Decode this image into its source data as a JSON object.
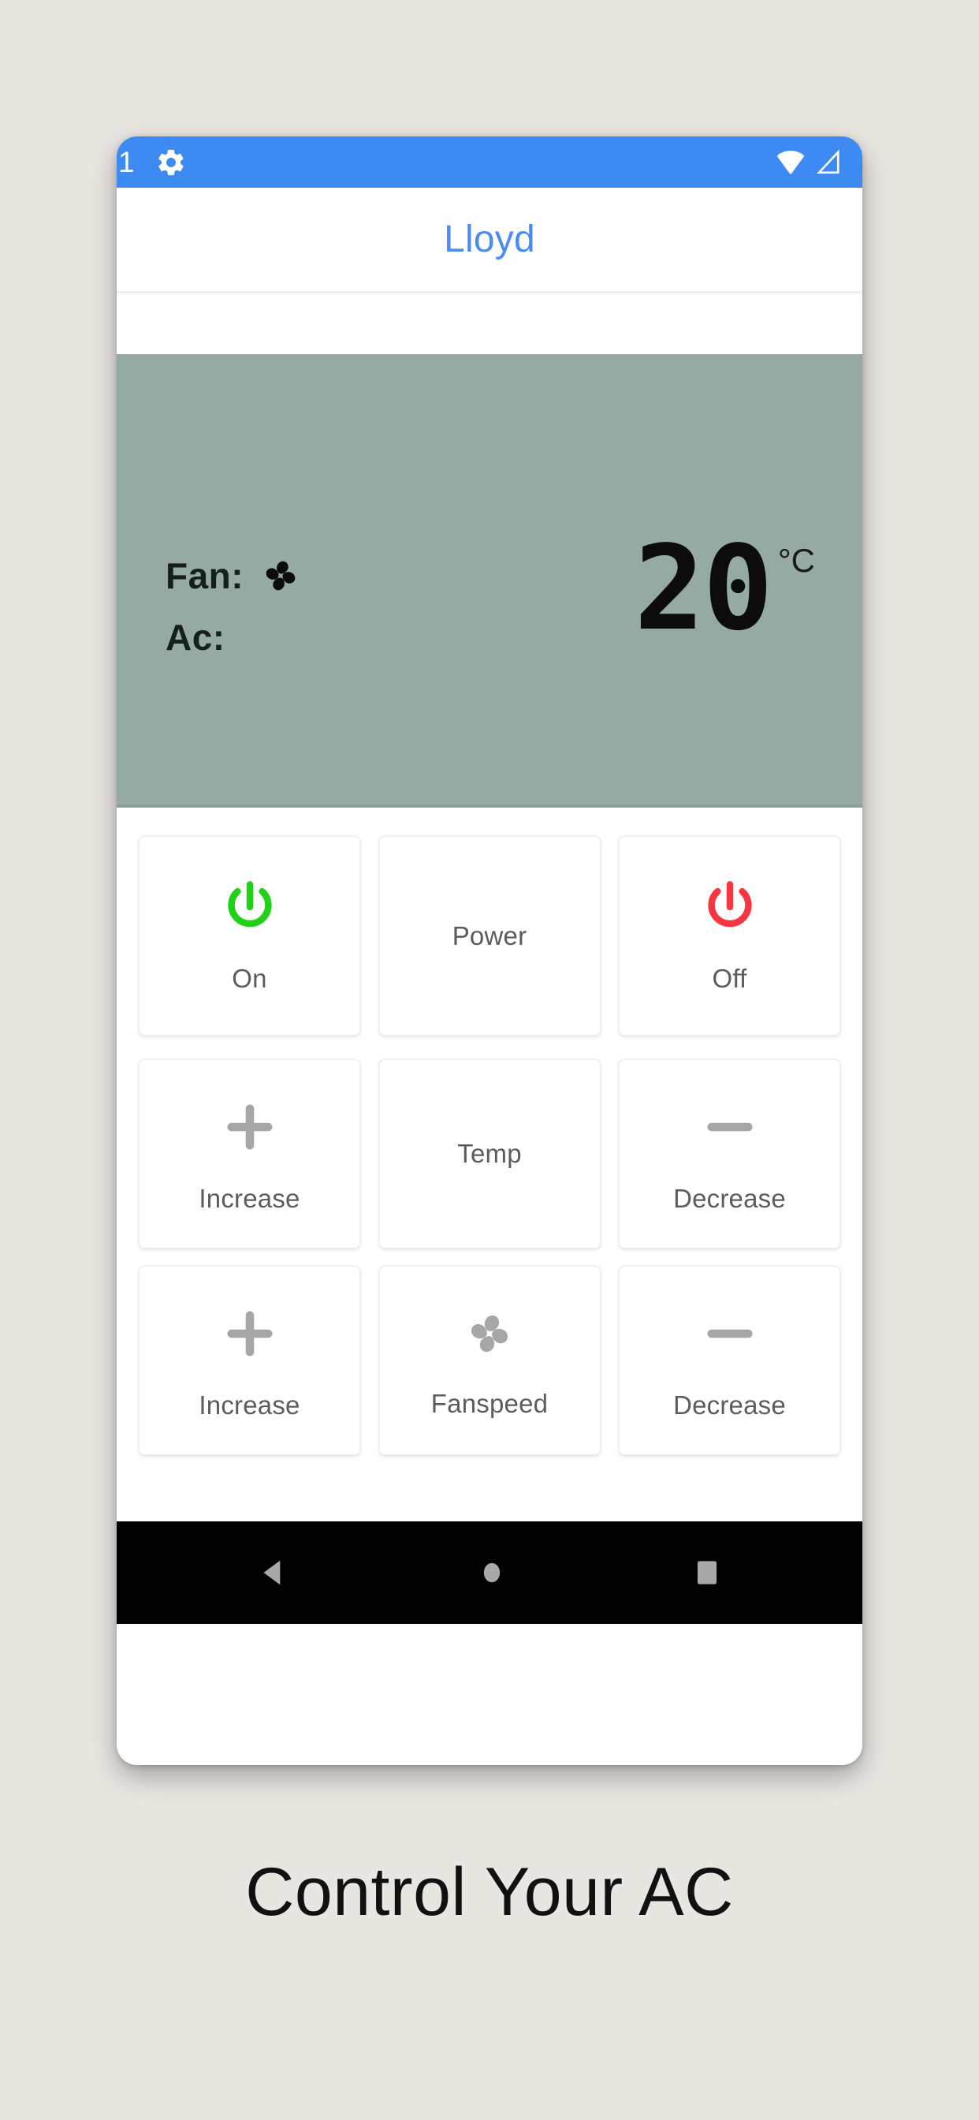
{
  "caption": "Control Your AC",
  "phone": {
    "statusbar": {
      "partial_glyph": "1",
      "icons": {
        "settings": "gear-icon",
        "wifi": "wifi-icon",
        "signal": "signal-triangle-icon"
      },
      "background_color": "#3d8bf2"
    },
    "titlebar": {
      "title": "Lloyd",
      "title_color": "#4a8cf0"
    },
    "display": {
      "background_color": "#96aaa4",
      "rows": [
        {
          "label": "Fan:",
          "value_icon": "fan-icon",
          "value": ""
        },
        {
          "label": "Ac:",
          "value_icon": "",
          "value": ""
        }
      ],
      "temperature": "20",
      "temperature_unit": "°C"
    },
    "controls": {
      "rows": [
        {
          "name": "power",
          "left": {
            "label": "On",
            "icon": "power-on-icon",
            "color": "#1fd118"
          },
          "center": {
            "label": "Power",
            "icon": "",
            "color": "#5c5c5c"
          },
          "right": {
            "label": "Off",
            "icon": "power-off-icon",
            "color": "#f7363f"
          }
        },
        {
          "name": "temp",
          "left": {
            "label": "Increase",
            "icon": "plus-icon",
            "color": "#a6a6a6"
          },
          "center": {
            "label": "Temp",
            "icon": "",
            "color": "#5c5c5c"
          },
          "right": {
            "label": "Decrease",
            "icon": "minus-icon",
            "color": "#a6a6a6"
          }
        },
        {
          "name": "fanspeed",
          "left": {
            "label": "Increase",
            "icon": "plus-icon",
            "color": "#a6a6a6"
          },
          "center": {
            "label": "Fanspeed",
            "icon": "fan-icon",
            "color": "#a6a6a6"
          },
          "right": {
            "label": "Decrease",
            "icon": "minus-icon",
            "color": "#a6a6a6"
          }
        }
      ]
    },
    "navbar": {
      "back": "back-triangle-icon",
      "home": "home-circle-icon",
      "recents": "recents-square-icon",
      "background_color": "#000000"
    }
  }
}
